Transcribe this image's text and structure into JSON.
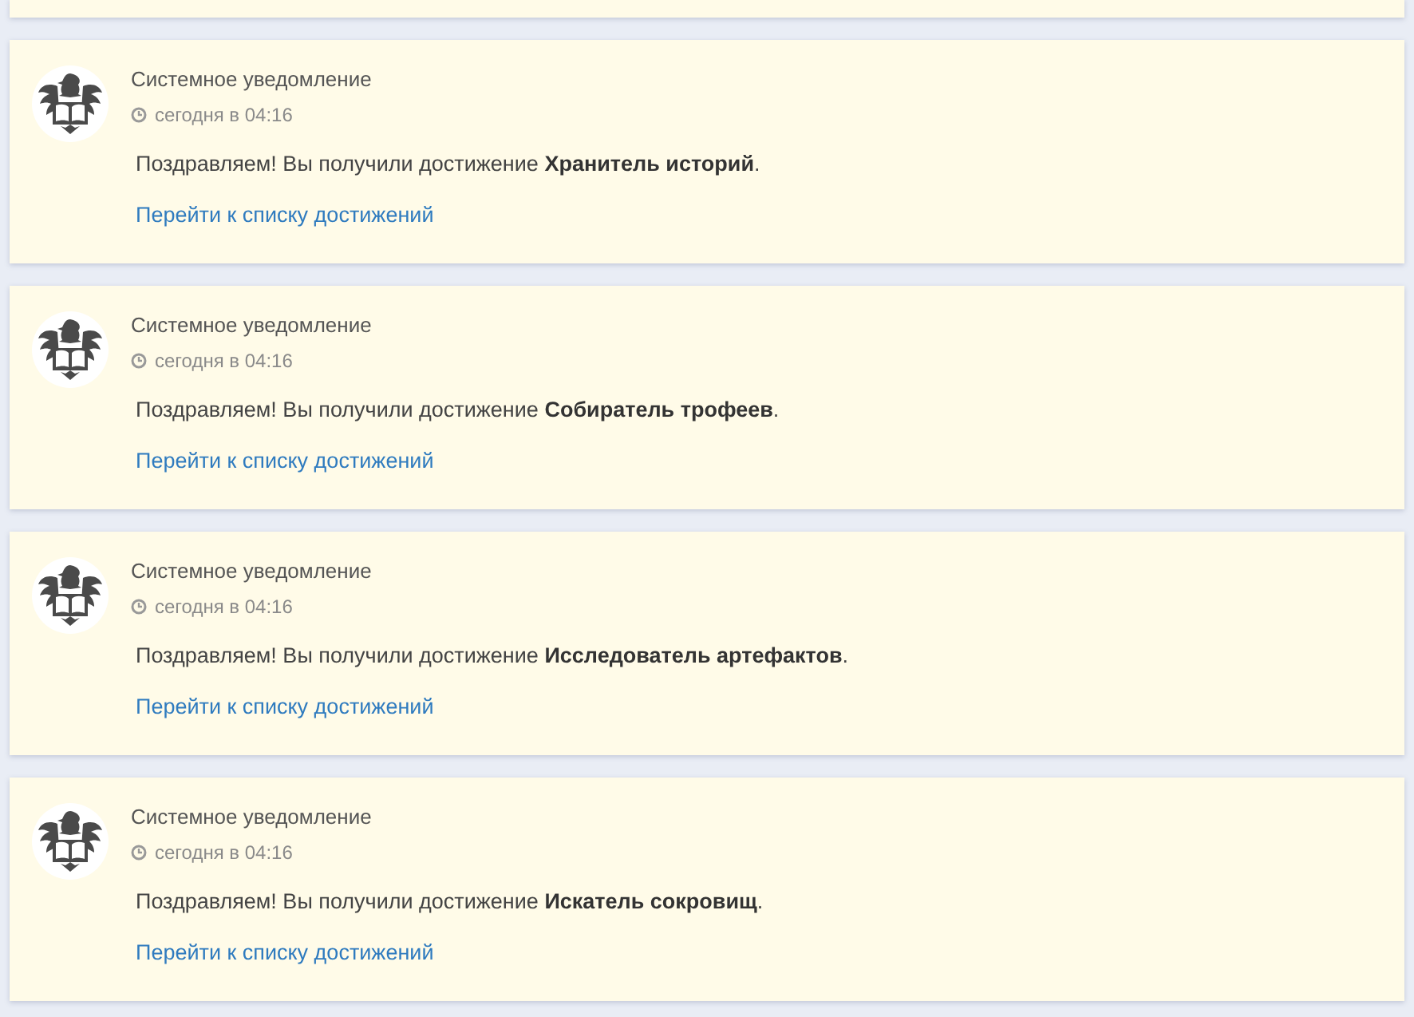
{
  "notifications": [
    {
      "sender": "Системное уведомление",
      "time": "сегодня в 04:16",
      "message": "Поздравляем! Вы получили достижение **Хранитель историй**.",
      "link": "Перейти к списку достижений"
    },
    {
      "sender": "Системное уведомление",
      "time": "сегодня в 04:16",
      "message": "Поздравляем! Вы получили достижение **Собиратель трофеев**.",
      "link": "Перейти к списку достижений"
    },
    {
      "sender": "Системное уведомление",
      "time": "сегодня в 04:16",
      "message": "Поздравляем! Вы получили достижение **Исследователь артефактов**.",
      "link": "Перейти к списку достижений"
    },
    {
      "sender": "Системное уведомление",
      "time": "сегодня в 04:16",
      "message": "Поздравляем! Вы получили достижение **Искатель сокровищ**.",
      "link": "Перейти к списку достижений"
    }
  ]
}
